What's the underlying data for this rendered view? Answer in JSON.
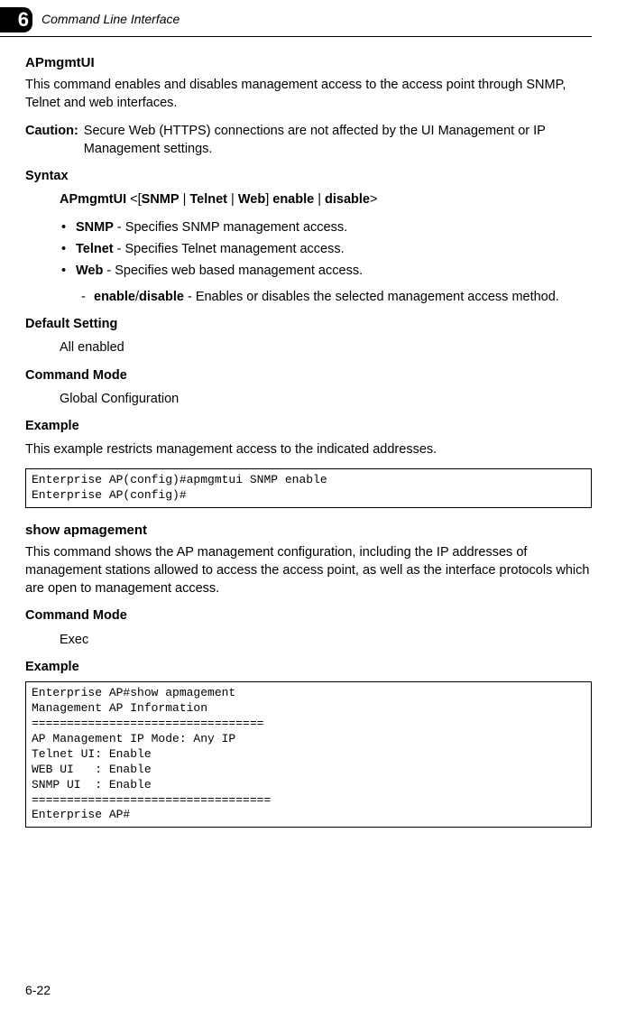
{
  "header": {
    "chapter": "6",
    "title": "Command Line Interface"
  },
  "cmd1": {
    "name": "APmgmtUI",
    "desc": "This command enables and disables management access to the access point through SNMP, Telnet and web interfaces.",
    "caution_label": "Caution:",
    "caution_text": "Secure Web (HTTPS) connections are not affected by the UI Management or IP Management settings.",
    "syntax_label": "Syntax",
    "syntax_cmd": "APmgmtUI",
    "syntax_opt_snmp": "SNMP",
    "syntax_opt_telnet": "Telnet",
    "syntax_opt_web": "Web",
    "syntax_enable": "enable",
    "syntax_disable": "disable",
    "bullet_snmp_b": "SNMP",
    "bullet_snmp_t": " - Specifies SNMP management access.",
    "bullet_telnet_b": "Telnet",
    "bullet_telnet_t": " - Specifies Telnet management access.",
    "bullet_web_b": "Web",
    "bullet_web_t": " - Specifies web based management access.",
    "sub_enable_b": "enable",
    "sub_slash": "/",
    "sub_disable_b": "disable",
    "sub_t": " - Enables or disables the selected management access method.",
    "default_label": "Default Setting",
    "default_value": "All enabled",
    "mode_label": "Command Mode",
    "mode_value": "Global Configuration",
    "example_label": "Example",
    "example_desc": "This example restricts management access to the indicated addresses.",
    "example_code": "Enterprise AP(config)#apmgmtui SNMP enable\nEnterprise AP(config)#"
  },
  "cmd2": {
    "name": "show apmagement",
    "desc": "This command shows the AP management configuration, including the IP addresses of management stations allowed to access the access point, as well as the interface protocols which are open to management access.",
    "mode_label": "Command Mode",
    "mode_value": "Exec",
    "example_label": "Example",
    "example_code": "Enterprise AP#show apmagement\nManagement AP Information\n=================================\nAP Management IP Mode: Any IP\nTelnet UI: Enable\nWEB UI   : Enable\nSNMP UI  : Enable\n==================================\nEnterprise AP#"
  },
  "page_number": "6-22"
}
